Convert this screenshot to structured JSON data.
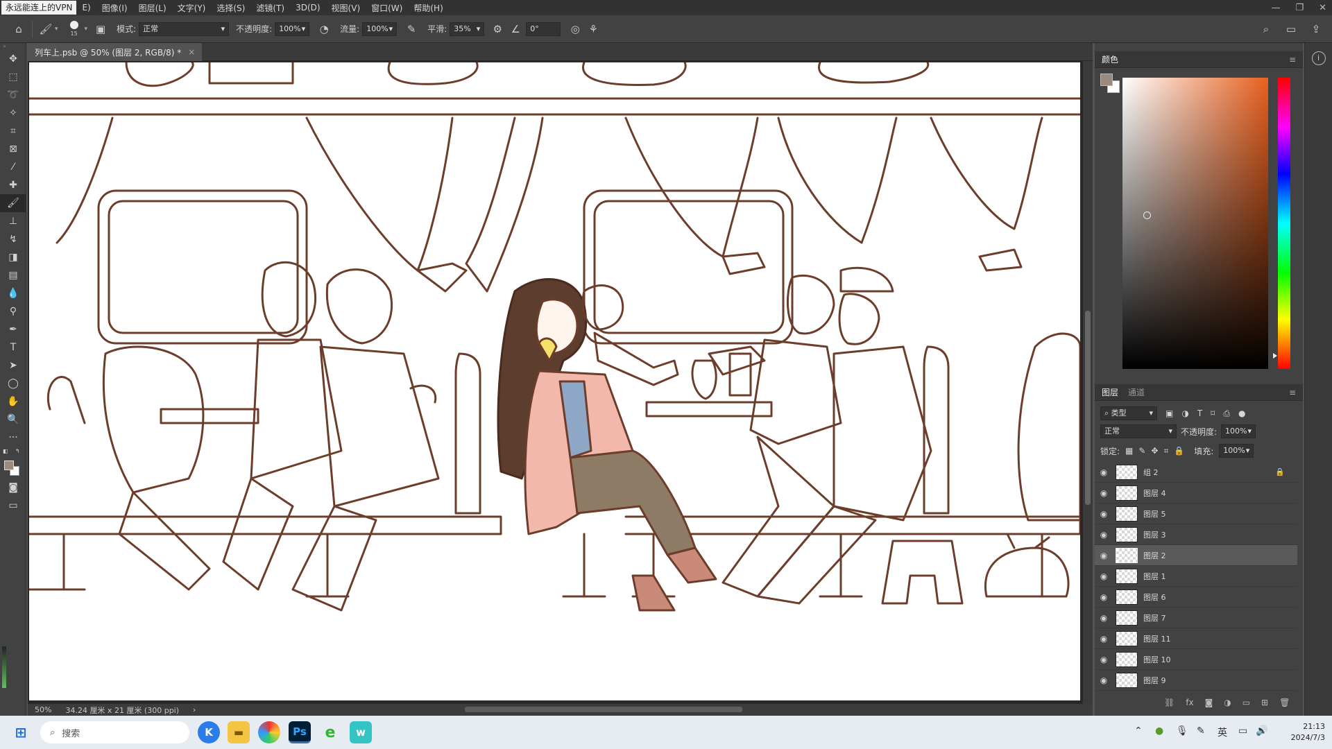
{
  "menubar": {
    "vpn_label": "永远能连上的VPN",
    "items": [
      "E)",
      "图像(I)",
      "图层(L)",
      "文字(Y)",
      "选择(S)",
      "滤镜(T)",
      "3D(D)",
      "视图(V)",
      "窗口(W)",
      "帮助(H)"
    ]
  },
  "options": {
    "brush_size": "15",
    "mode_label": "模式:",
    "mode_value": "正常",
    "opacity_label": "不透明度:",
    "opacity_value": "100%",
    "flow_label": "流量:",
    "flow_value": "100%",
    "smooth_label": "平滑:",
    "smooth_value": "35%",
    "angle_value": "0°"
  },
  "document": {
    "tab_title": "列车上.psb @ 50% (图层 2, RGB/8) *",
    "zoom": "50%",
    "doc_size": "34.24 厘米 x 21 厘米 (300 ppi)"
  },
  "color_panel": {
    "title": "颜色",
    "foreground": "#9b8a7e",
    "background": "#ffffff"
  },
  "layers_panel": {
    "tab_layers": "图层",
    "tab_channels": "通道",
    "filter_type": "类型",
    "blend_mode": "正常",
    "opacity_label": "不透明度:",
    "opacity_value": "100%",
    "lock_label": "锁定:",
    "fill_label": "填充:",
    "fill_value": "100%",
    "layers": [
      {
        "name": "组 2",
        "locked": true
      },
      {
        "name": "图层 4"
      },
      {
        "name": "图层 5"
      },
      {
        "name": "图层 3"
      },
      {
        "name": "图层 2",
        "selected": true
      },
      {
        "name": "图层 1"
      },
      {
        "name": "图层 6"
      },
      {
        "name": "图层 7"
      },
      {
        "name": "图层 11"
      },
      {
        "name": "图层 10"
      },
      {
        "name": "图层 9"
      }
    ]
  },
  "taskbar": {
    "search_placeholder": "搜索",
    "ime": "英",
    "time": "21:13",
    "date": "2024/7/3"
  }
}
